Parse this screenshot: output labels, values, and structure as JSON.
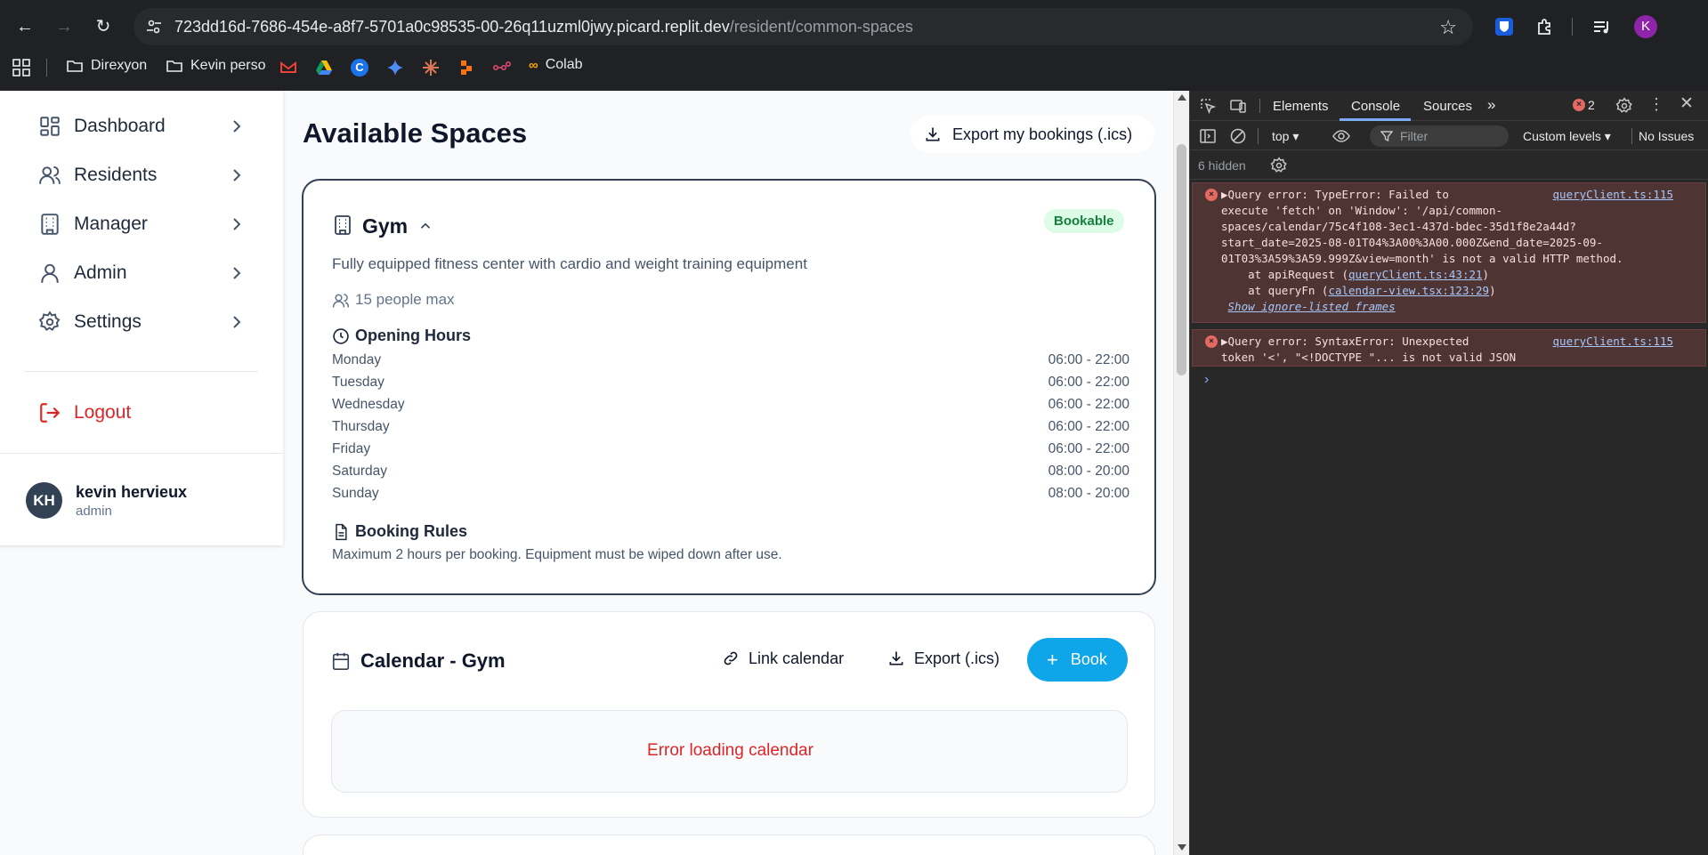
{
  "browser": {
    "url_host": "723dd16d-7686-454e-a8f7-5701a0c98535-00-26q11uzml0jwy.picard.replit.dev",
    "url_path": "/resident/common-spaces",
    "profile_initial": "K",
    "bookmarks": [
      "Direxyon",
      "Kevin perso",
      "Colab"
    ]
  },
  "sidebar": {
    "items": [
      {
        "label": "Dashboard",
        "icon": "dashboard-icon"
      },
      {
        "label": "Residents",
        "icon": "users-icon"
      },
      {
        "label": "Manager",
        "icon": "building-icon"
      },
      {
        "label": "Admin",
        "icon": "user-icon"
      },
      {
        "label": "Settings",
        "icon": "gear-icon"
      }
    ],
    "logout_label": "Logout",
    "user": {
      "initials": "KH",
      "name": "kevin hervieux",
      "role": "admin"
    }
  },
  "main": {
    "title": "Available Spaces",
    "export_my_label": "Export my bookings (.ics)",
    "space": {
      "name": "Gym",
      "badge": "Bookable",
      "description": "Fully equipped fitness center with cardio and weight training equipment",
      "capacity": "15 people max",
      "hours_title": "Opening Hours",
      "hours": [
        {
          "day": "Monday",
          "time": "06:00 - 22:00"
        },
        {
          "day": "Tuesday",
          "time": "06:00 - 22:00"
        },
        {
          "day": "Wednesday",
          "time": "06:00 - 22:00"
        },
        {
          "day": "Thursday",
          "time": "06:00 - 22:00"
        },
        {
          "day": "Friday",
          "time": "06:00 - 22:00"
        },
        {
          "day": "Saturday",
          "time": "08:00 - 20:00"
        },
        {
          "day": "Sunday",
          "time": "08:00 - 20:00"
        }
      ],
      "rules_title": "Booking Rules",
      "rules_text": "Maximum 2 hours per booking. Equipment must be wiped down after use."
    },
    "calendar": {
      "title": "Calendar - Gym",
      "link_label": "Link calendar",
      "export_label": "Export (.ics)",
      "book_label": "Book",
      "error": "Error loading calendar"
    }
  },
  "devtools": {
    "tabs": [
      "Elements",
      "Console",
      "Sources"
    ],
    "active_tab": "Console",
    "error_count": "2",
    "context": "top",
    "filter_placeholder": "Filter",
    "levels": "Custom levels",
    "issues": "No Issues",
    "hidden": "6 hidden",
    "messages": [
      {
        "text": "Query error: TypeError: Failed to\nexecute 'fetch' on 'Window': '/api/common-\nspaces/calendar/75c4f108-3ec1-437d-bdec-35d1f8e2a44d?\nstart_date=2025-08-01T04%3A00%3A00.000Z&end_date=2025-09-\n01T03%3A59%3A59.999Z&view=month' is not a valid HTTP method.",
        "source": "queryClient.ts:115",
        "stack": [
          {
            "fn": "at apiRequest",
            "loc": "queryClient.ts:43:21"
          },
          {
            "fn": "at queryFn",
            "loc": "calendar-view.tsx:123:29"
          }
        ],
        "show_ignore": "Show ignore-listed frames"
      },
      {
        "text": "Query error: SyntaxError: Unexpected\ntoken '<', \"<!DOCTYPE \"... is not valid JSON",
        "source": "queryClient.ts:115"
      }
    ]
  },
  "colors": {
    "accent": "#0ea5e9",
    "error": "#dc2626",
    "badge_bg": "#dcfce7",
    "badge_text": "#15803d"
  }
}
